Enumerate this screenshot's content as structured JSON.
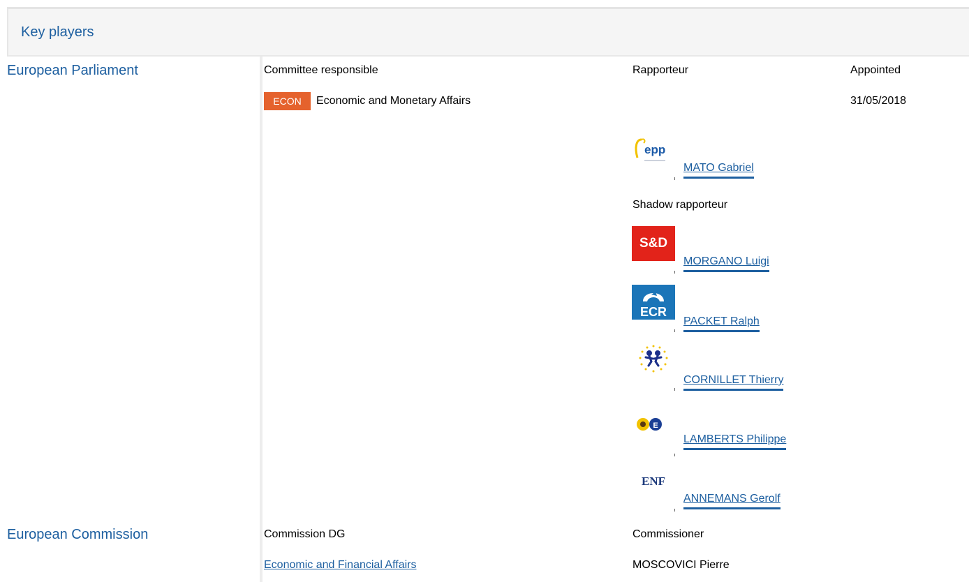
{
  "header": {
    "title": "Key players"
  },
  "parliament": {
    "label": "European Parliament",
    "col_committee": "Committee responsible",
    "col_rapporteur": "Rapporteur",
    "col_appointed": "Appointed",
    "committee_code": "ECON",
    "committee_name": "Economic and Monetary Affairs",
    "appointed_date": "31/05/2018",
    "rapporteur": {
      "name": "MATO Gabriel",
      "group_logo": "epp-logo",
      "logo_text": "epp"
    },
    "shadow_label": "Shadow rapporteur",
    "shadows": [
      {
        "name": "MORGANO Luigi",
        "group_logo": "sd-logo",
        "logo_text": "S&D"
      },
      {
        "name": "PACKET Ralph",
        "group_logo": "ecr-logo",
        "logo_text": "ECR"
      },
      {
        "name": "CORNILLET Thierry",
        "group_logo": "alde-logo"
      },
      {
        "name": "LAMBERTS Philippe",
        "group_logo": "greens-efa-logo"
      },
      {
        "name": "ANNEMANS Gerolf",
        "group_logo": "enf-logo",
        "logo_text": "ENF"
      }
    ]
  },
  "commission": {
    "label": "European Commission",
    "col_dg": "Commission DG",
    "col_commissioner": "Commissioner",
    "dg": "Economic and Financial Affairs",
    "commissioner": "MOSCOVICI Pierre"
  },
  "colors": {
    "link": "#1d5fa0",
    "badge": "#e5622d",
    "sd_red": "#e2231a",
    "ecr_blue": "#1b75b8"
  }
}
